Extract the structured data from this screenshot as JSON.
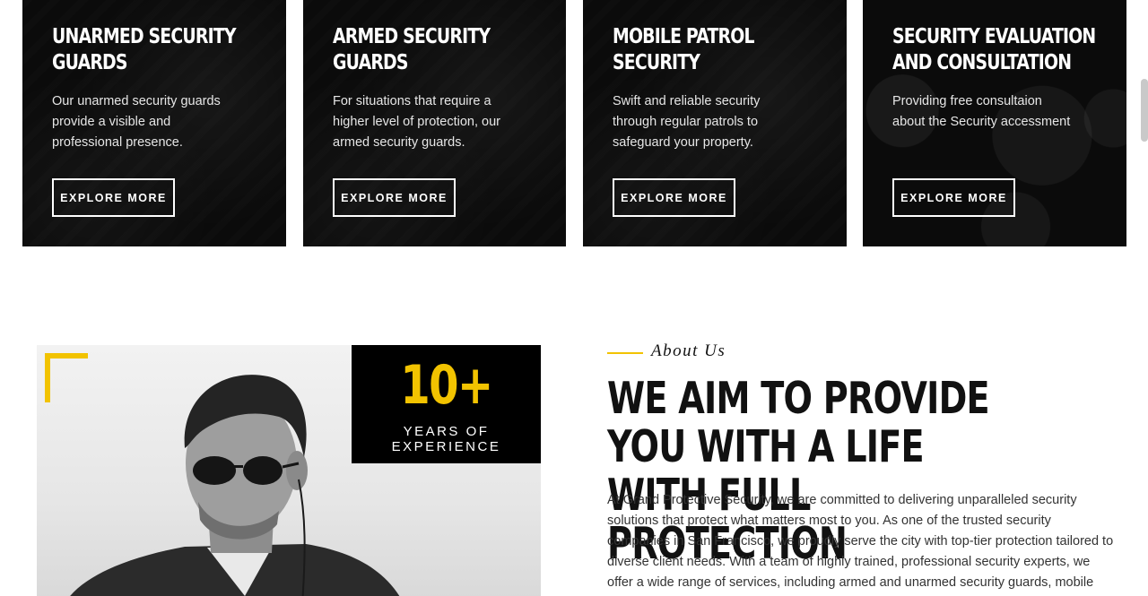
{
  "services": [
    {
      "title_line1": "Unarmed Security",
      "title_line2": "Guards",
      "description": "Our unarmed security guards provide a visible and professional presence.",
      "button_label": "Explore More"
    },
    {
      "title_line1": "Armed Security",
      "title_line2": "Guards",
      "description": "For situations that require a higher level of protection, our armed security guards.",
      "button_label": "Explore More"
    },
    {
      "title_line1": "Mobile Patrol",
      "title_line2": "Security",
      "description": "Swift and reliable security through regular patrols to safeguard your property.",
      "button_label": "Explore More"
    },
    {
      "title_line1": "Security Evaluation",
      "title_line2": "and Consultation",
      "description": "Providing free consultaion about the Security accessment",
      "button_label": "Explore More"
    }
  ],
  "about": {
    "experience_number": "10+",
    "experience_label": "Years of Experience",
    "eyebrow": "About Us",
    "heading_line1": "We aim to provide you with a life",
    "heading_line2": "with full protection",
    "body": "At Grand Protective Security, we are committed to delivering unparalleled security solutions that protect what matters most to you. As one of the trusted security companies in San Francisco, we proudly serve the city with top-tier protection tailored to diverse client needs. With a team of highly trained, professional security experts, we offer a wide range of services, including armed and unarmed security guards, mobile patrols,"
  },
  "colors": {
    "accent": "#f2c300",
    "card_bg": "#0b0b0b",
    "text_dark": "#111111"
  }
}
